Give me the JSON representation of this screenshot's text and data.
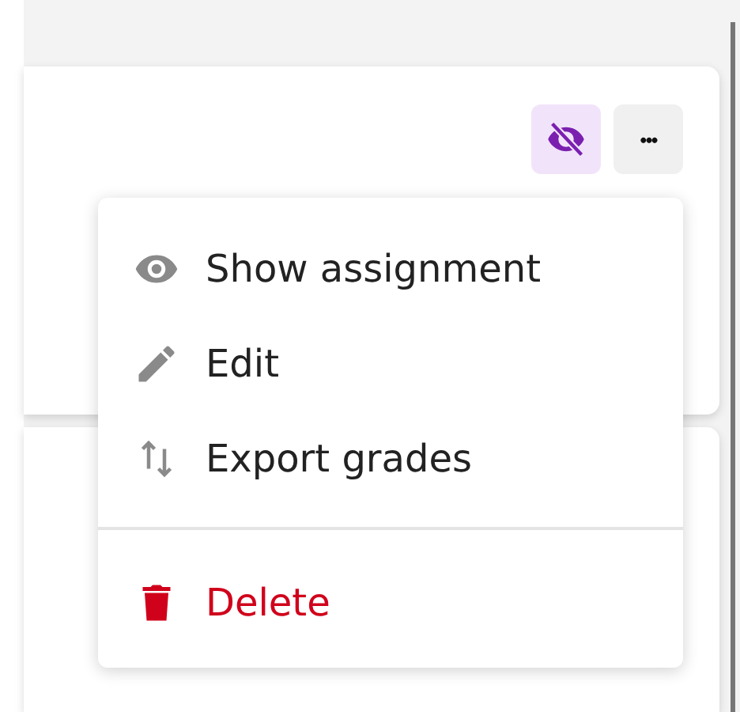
{
  "card": {
    "visibility_button": {
      "hidden": true
    },
    "more_button": {
      "label": "•••"
    }
  },
  "menu": {
    "groups": [
      {
        "items": [
          {
            "kind": "show",
            "label": "Show assignment"
          },
          {
            "kind": "edit",
            "label": "Edit"
          },
          {
            "kind": "export",
            "label": "Export grades"
          }
        ]
      },
      {
        "items": [
          {
            "kind": "delete",
            "label": "Delete"
          }
        ]
      }
    ]
  }
}
